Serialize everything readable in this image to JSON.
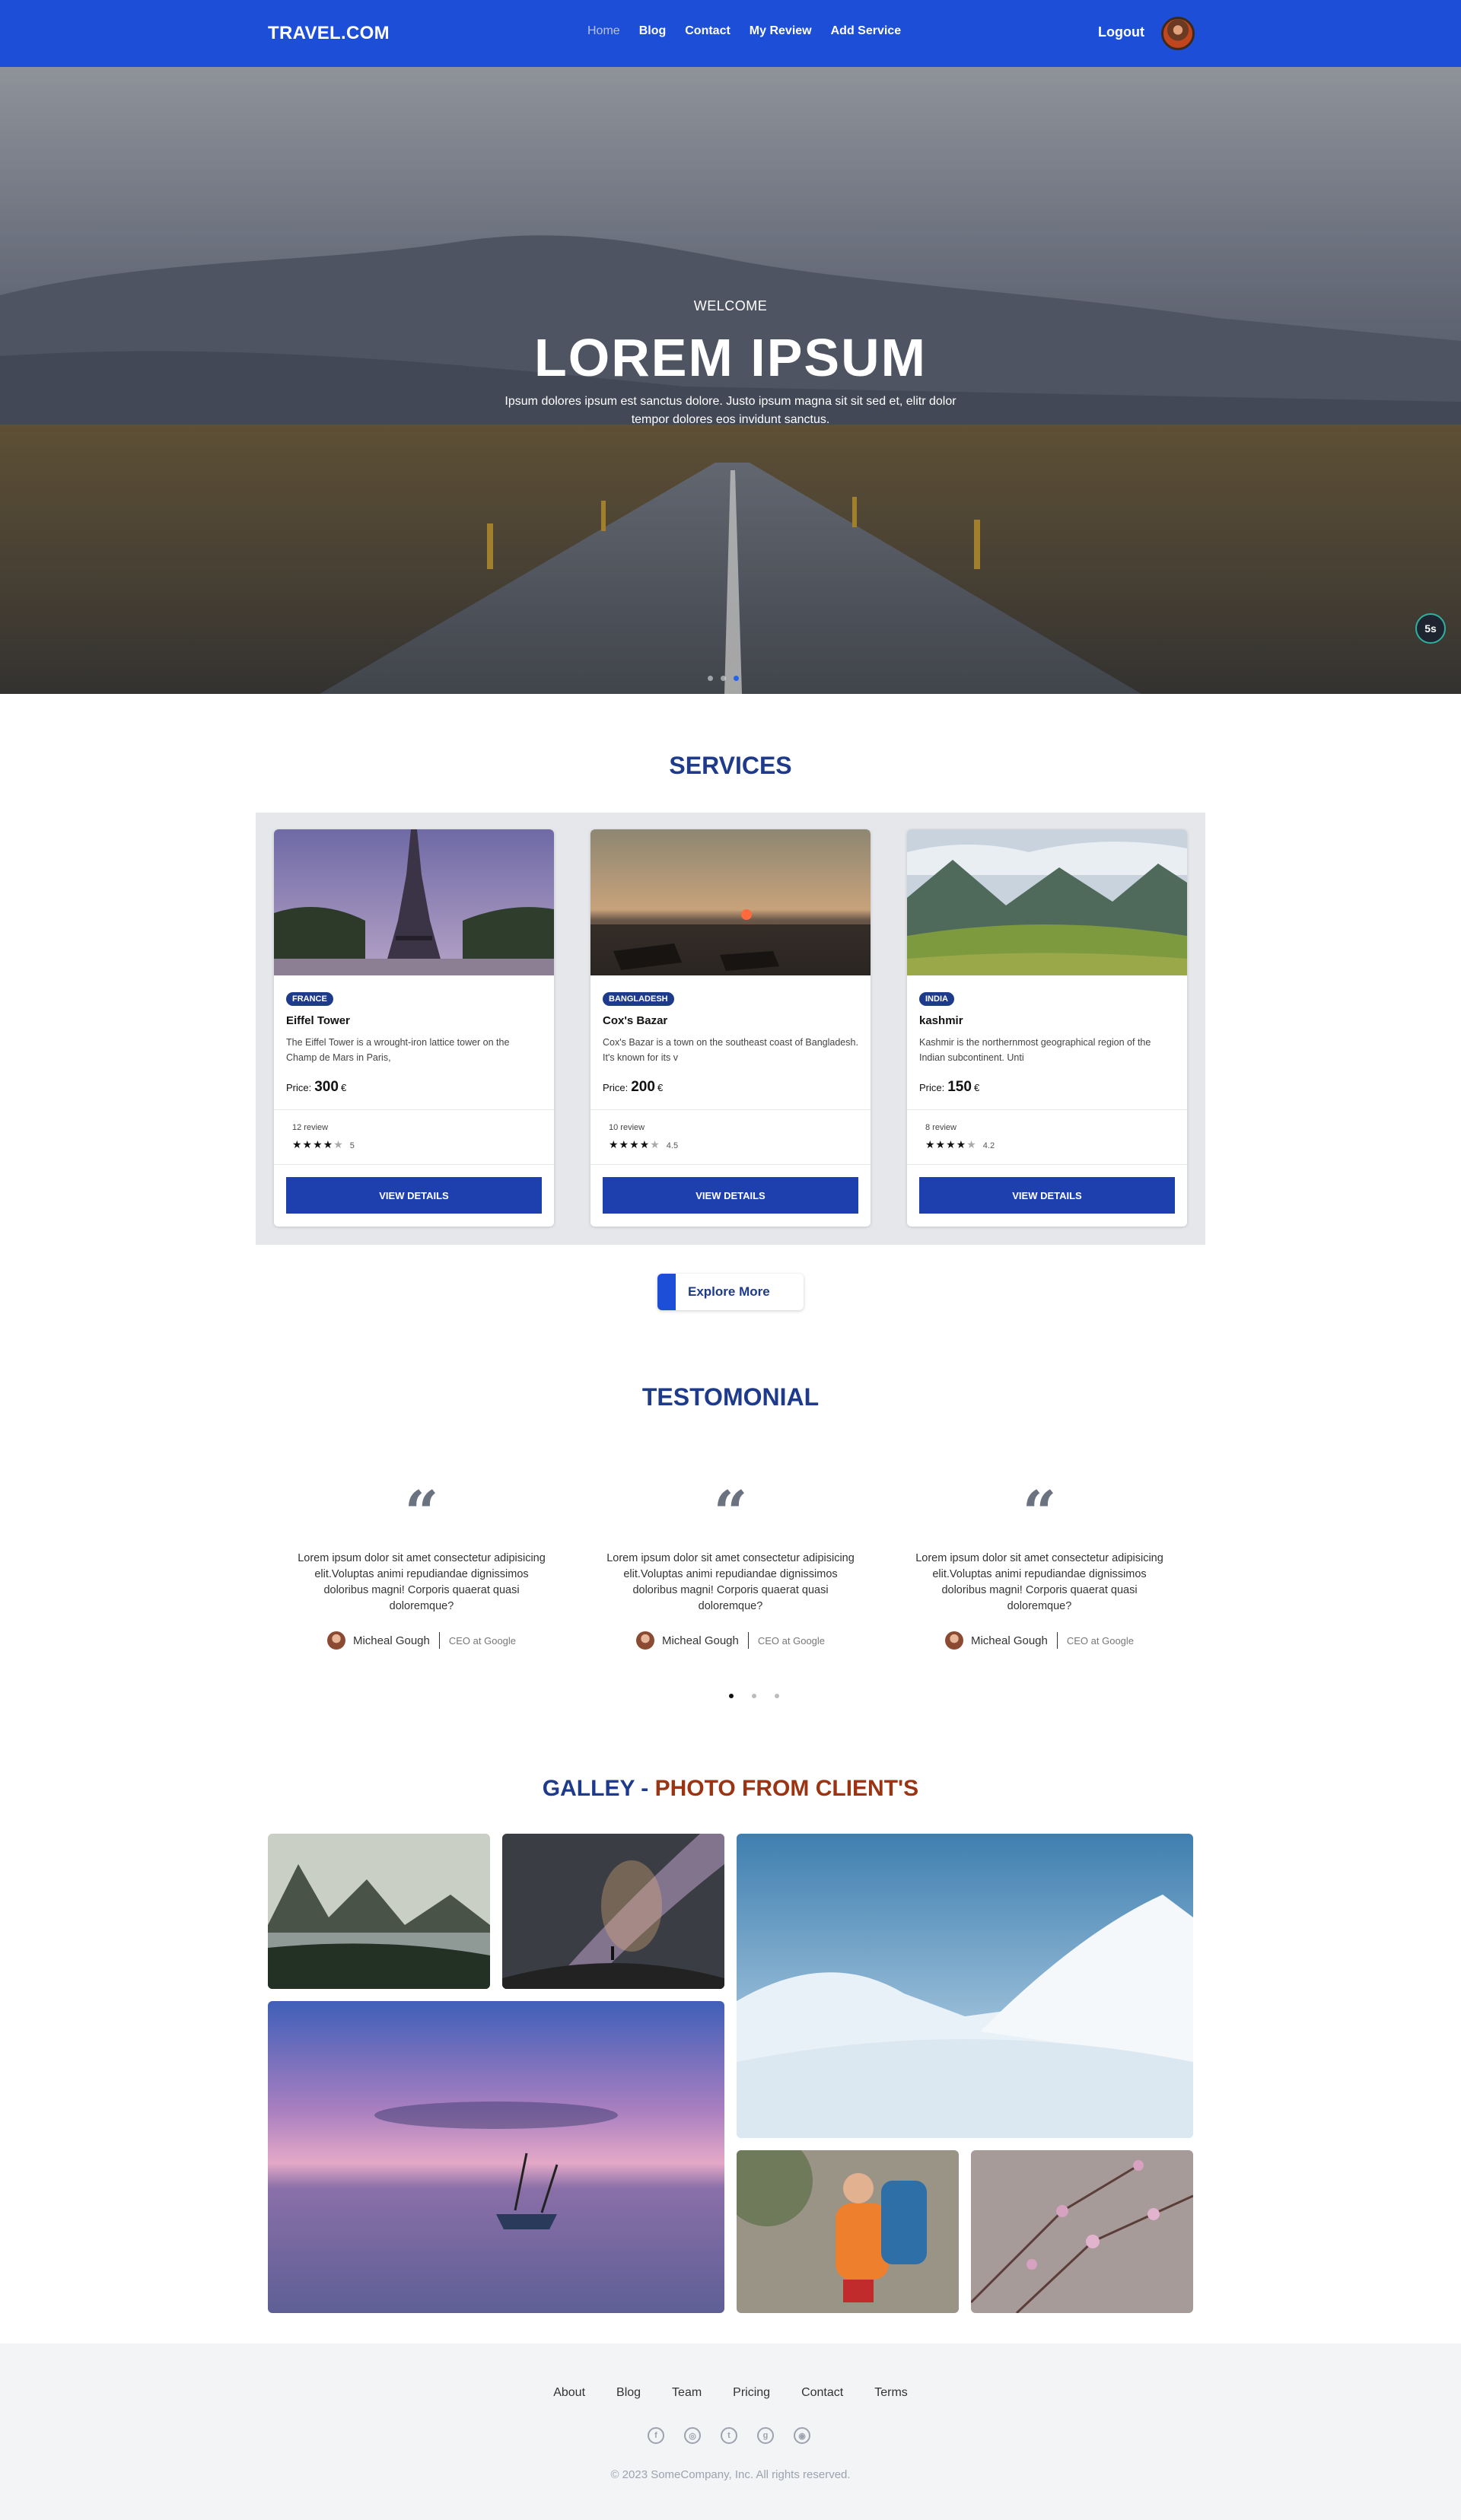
{
  "nav": {
    "brand": "TRAVEL.COM",
    "links": [
      "Home",
      "Blog",
      "Contact",
      "My Review",
      "Add Service"
    ],
    "logout": "Logout"
  },
  "hero": {
    "subtitle": "WELCOME",
    "title": "LOREM IPSUM",
    "text": "Ipsum dolores ipsum est sanctus dolore. Justo ipsum magna sit sit sed et, elitr dolor tempor dolores eos invidunt sanctus.",
    "timer": "5s",
    "slide_count": 3,
    "active_slide": 3
  },
  "services": {
    "title": "SERVICES",
    "cards": [
      {
        "country": "FRANCE",
        "name": "Eiffel Tower",
        "desc": "The Eiffel Tower is a wrought-iron lattice tower on the Champ de Mars in Paris,",
        "price_label": "Price:",
        "price": "300",
        "currency": "€",
        "reviews": "12 review",
        "rating": "5",
        "stars": 4,
        "button": "VIEW DETAILS"
      },
      {
        "country": "BANGLADESH",
        "name": "Cox's Bazar",
        "desc": "Cox's Bazar is a town on the southeast coast of Bangladesh. It's known for its v",
        "price_label": "Price:",
        "price": "200",
        "currency": "€",
        "reviews": "10 review",
        "rating": "4.5",
        "stars": 4,
        "button": "VIEW DETAILS"
      },
      {
        "country": "INDIA",
        "name": "kashmir",
        "desc": "Kashmir is the northernmost geographical region of the Indian subcontinent. Unti",
        "price_label": "Price:",
        "price": "150",
        "currency": "€",
        "reviews": "8 review",
        "rating": "4.2",
        "stars": 4,
        "button": "VIEW DETAILS"
      }
    ],
    "explore": "Explore More"
  },
  "testimonial": {
    "title": "TESTOMONIAL",
    "quote_mark": "“",
    "items": [
      {
        "text": "Lorem ipsum dolor sit amet consectetur adipisicing elit.Voluptas animi repudiandae dignissimos doloribus magni! Corporis quaerat quasi doloremque?",
        "author": "Micheal Gough",
        "role": "CEO at Google"
      },
      {
        "text": "Lorem ipsum dolor sit amet consectetur adipisicing elit.Voluptas animi repudiandae dignissimos doloribus magni! Corporis quaerat quasi doloremque?",
        "author": "Micheal Gough",
        "role": "CEO at Google"
      },
      {
        "text": "Lorem ipsum dolor sit amet consectetur adipisicing elit.Voluptas animi repudiandae dignissimos doloribus magni! Corporis quaerat quasi doloremque?",
        "author": "Micheal Gough",
        "role": "CEO at Google"
      }
    ],
    "page_count": 3,
    "active_page": 1
  },
  "gallery": {
    "title_part1": "GALLEY - ",
    "title_part2": "PHOTO FROM CLIENT'S"
  },
  "footer": {
    "links": [
      "About",
      "Blog",
      "Team",
      "Pricing",
      "Contact",
      "Terms"
    ],
    "social": [
      {
        "icon": "facebook-icon",
        "glyph": "f"
      },
      {
        "icon": "instagram-icon",
        "glyph": "◎"
      },
      {
        "icon": "twitter-icon",
        "glyph": "t"
      },
      {
        "icon": "github-icon",
        "glyph": "g"
      },
      {
        "icon": "dribbble-icon",
        "glyph": "◉"
      }
    ],
    "copyright": "© 2023 SomeCompany, Inc. All rights reserved."
  },
  "colors": {
    "primary": "#1d4ed8",
    "heading": "#1e3a8a",
    "accent": "#9a3412",
    "footer_bg": "#f3f4f6"
  }
}
